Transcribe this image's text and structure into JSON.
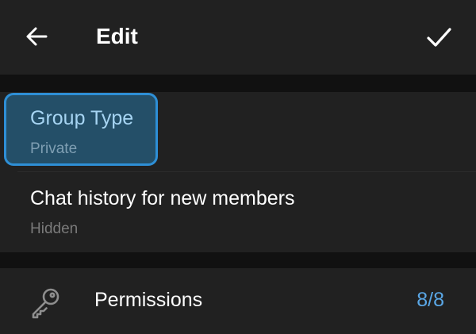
{
  "header": {
    "title": "Edit",
    "back_icon": "arrow-left-icon",
    "done_icon": "checkmark-icon"
  },
  "settings": {
    "group_type": {
      "label": "Group Type",
      "value": "Private",
      "highlighted": true
    },
    "chat_history": {
      "label": "Chat history for new members",
      "value": "Hidden"
    }
  },
  "permissions": {
    "icon": "key-icon",
    "label": "Permissions",
    "value": "8/8"
  },
  "colors": {
    "background": "#1c1c1c",
    "surface": "#212121",
    "accent": "#2e8fd6",
    "accent_text": "#5aa7e6",
    "secondary_text": "#7a7a7a"
  }
}
